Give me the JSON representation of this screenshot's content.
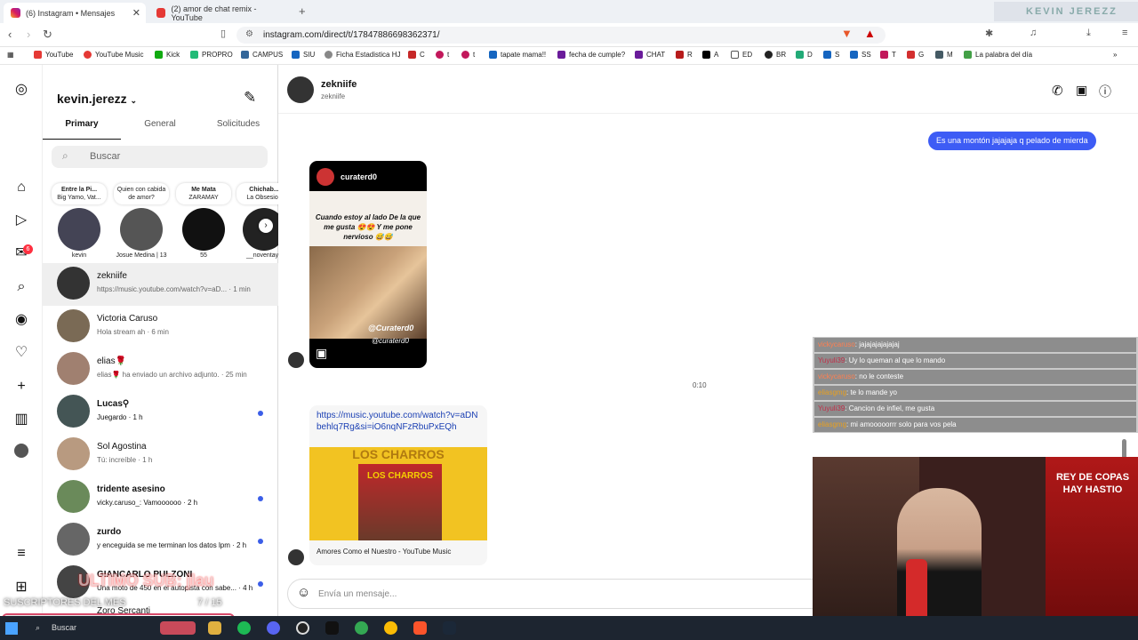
{
  "browser": {
    "tabs": [
      {
        "title": "(6) Instagram • Mensajes",
        "active": true
      },
      {
        "title": "(2) amor de chat remix - YouTube",
        "active": false
      }
    ],
    "url": "instagram.com/direct/t/17847886698362371/",
    "bookmarks": [
      "YouTube",
      "YouTube Music",
      "Kick",
      "PROPRO",
      "CAMPUS",
      "SIU",
      "Ficha Estadistica HJ",
      "C",
      "t",
      "t",
      "tapate mama!!",
      "fecha de cumple?",
      "CHAT",
      "R",
      "A",
      "ED",
      "BR",
      "D",
      "S",
      "SS",
      "T",
      "G",
      "M",
      "La palabra del día"
    ],
    "stream_logo": "KEVIN JEREZZ"
  },
  "nav": {
    "badge": "6"
  },
  "inbox": {
    "username": "kevin.jerezz",
    "tabs": [
      "Primary",
      "General",
      "Solicitudes"
    ],
    "search_placeholder": "Buscar",
    "notes": [
      {
        "title": "Entre la Pi...",
        "sub": "Big Yamo, Vat...",
        "name": "kevin"
      },
      {
        "title": "Quien con cabida de amor?",
        "sub": "",
        "name": "Josue Medina | 13"
      },
      {
        "title": "Me Mata",
        "sub": "ZARAMAY",
        "name": "55"
      },
      {
        "title": "Chichab...",
        "sub": "La Obsesion",
        "name": "__noventayn"
      }
    ],
    "conversations": [
      {
        "name": "zekniife",
        "preview": "https://music.youtube.com/watch?v=aD...",
        "time": "· 1 min",
        "unread": false
      },
      {
        "name": "Victoria Caruso",
        "preview": "Hola stream ah",
        "time": "· 6 min",
        "unread": false
      },
      {
        "name": "elias🌹",
        "preview": "elias🌹 ha enviado un archivo adjunto.",
        "time": "· 25 min",
        "unread": false
      },
      {
        "name": "Lucas⚲",
        "preview": "Juegardo",
        "time": "· 1 h",
        "unread": true
      },
      {
        "name": "Sol Agostina",
        "preview": "Tú: increíble",
        "time": "· 1 h",
        "unread": false
      },
      {
        "name": "tridente asesino",
        "preview": "vicky.caruso_: Vamoooooo",
        "time": "· 2 h",
        "unread": true
      },
      {
        "name": "zurdo",
        "preview": "y enceguida se me terminan los datos lpm",
        "time": "· 2 h",
        "unread": true
      },
      {
        "name": "GIANCARLO PULZONI",
        "preview": "Una moto de 450 en el autopista con sabe...",
        "time": "· 4 h",
        "unread": true
      },
      {
        "name": "Zoro Sercanti",
        "preview": "",
        "time": "",
        "unread": false
      }
    ]
  },
  "chat": {
    "name": "zekniife",
    "handle": "zekniife",
    "sent_message": "Es una montón jajajaja q pelado de mierda",
    "reel": {
      "account": "curaterd0",
      "caption": "Cuando estoy al lado De la que me gusta 😍😍 Y me pone nervioso 😅😅",
      "watermark1": "@Curaterd0",
      "watermark2": "@curaterd0"
    },
    "timestamp": "0:10",
    "link": {
      "url": "https://music.youtube.com/watch?v=aDNbehlq7Rg&si=iO6nqNFzRbuPxEQh",
      "header": "LOS CHARROS",
      "album": "LOS CHARROS",
      "title": "Amores Como el Nuestro - YouTube Music"
    },
    "composer_placeholder": "Envía un mensaje..."
  },
  "twitch_chat": [
    {
      "user": "vickycaruso",
      "text": ": jajajajajajajaj",
      "color": "#ff7f50"
    },
    {
      "user": "Yuyuli39",
      "text": ": Uy lo queman al que lo mando",
      "color": "#c0304a"
    },
    {
      "user": "vickycaruso",
      "text": ": no le conteste",
      "color": "#ff7f50"
    },
    {
      "user": "eliasgmg",
      "text": ": te lo mande yo",
      "color": "#e8a020"
    },
    {
      "user": "Yuyuli39",
      "text": ": Cancion de infiel, me gusta",
      "color": "#c0304a"
    },
    {
      "user": "eliasgmg",
      "text": ": mi amooooorrr solo para vos pela",
      "color": "#e8a020"
    }
  ],
  "stream_overlay": {
    "last_sub": "ULTIMO SUB: jlau",
    "subs_label": "SUSCRIPTORES DEL MES",
    "subs_count": "7 / 15",
    "webcam_banner": "REY DE COPAS HAY HASTIO"
  },
  "taskbar": {
    "search_label": "Buscar"
  }
}
